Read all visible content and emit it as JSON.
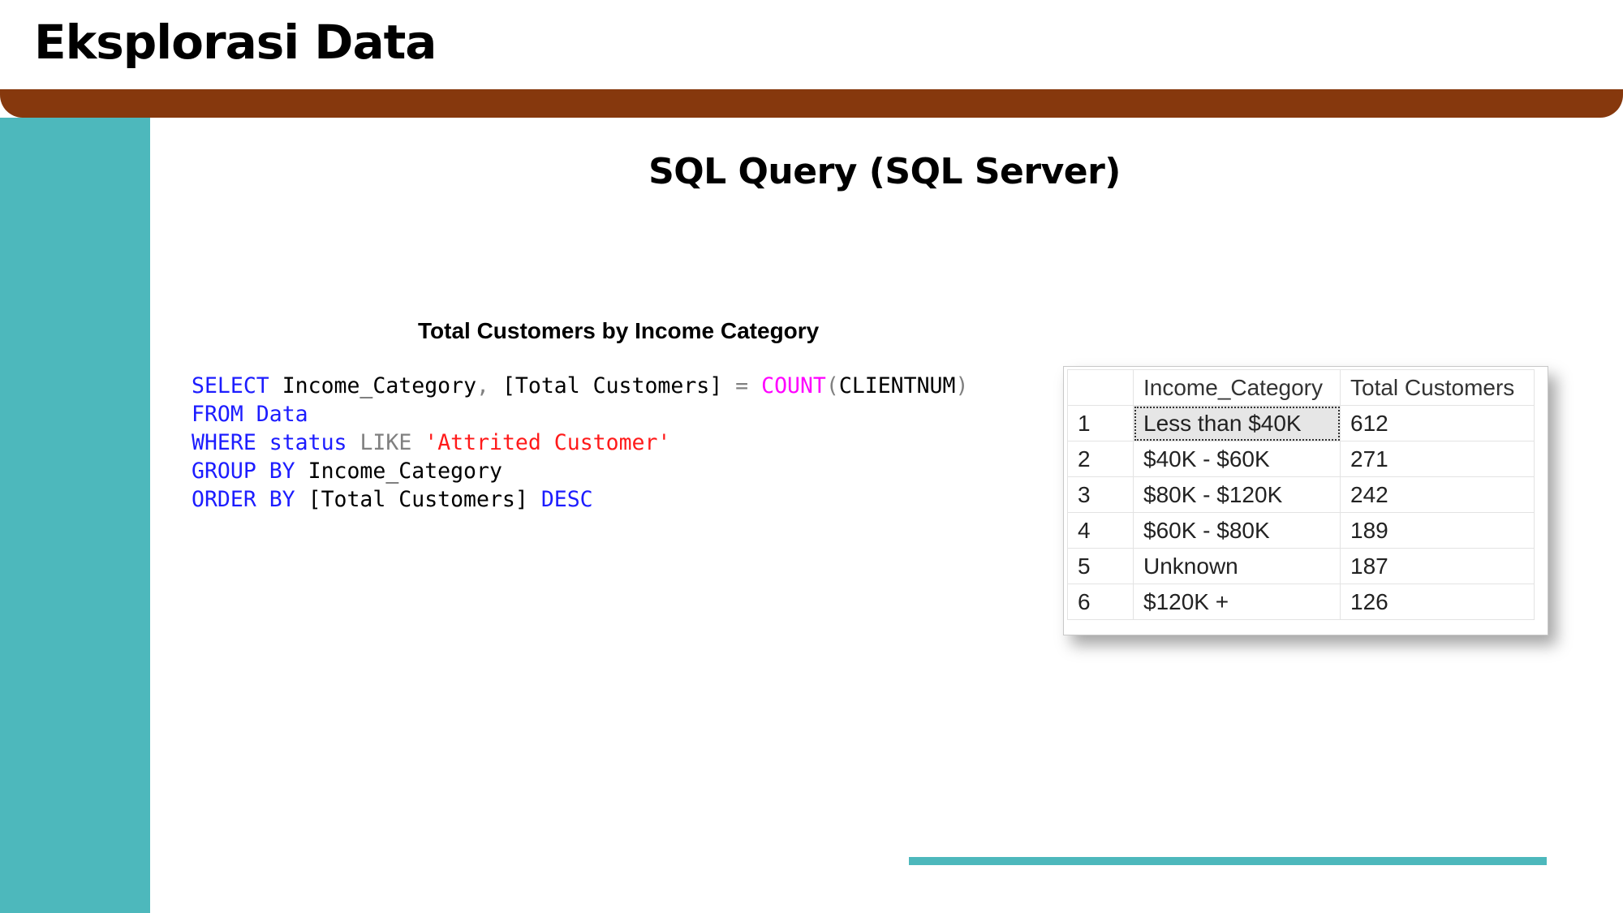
{
  "slide": {
    "title": "Eksplorasi Data",
    "subtitle": "SQL Query (SQL Server)",
    "section_title": "Total Customers by Income Category"
  },
  "sql": {
    "select": "SELECT",
    "col1": "Income_Category",
    "comma": ",",
    "alias": "[Total Customers]",
    "equals": "=",
    "count_fn": "COUNT",
    "paren_open": "(",
    "count_arg": "CLIENTNUM",
    "paren_close": ")",
    "from": "FROM",
    "table": "Data",
    "where": "WHERE",
    "where_col": "status",
    "like": "LIKE",
    "literal": "'Attrited Customer'",
    "group_by": "GROUP BY",
    "group_col": "Income_Category",
    "order_by": "ORDER BY",
    "order_col": "[Total Customers]",
    "desc": "DESC"
  },
  "results": {
    "columns": [
      "Income_Category",
      "Total Customers"
    ],
    "rows": [
      {
        "num": "1",
        "category": "Less than $40K",
        "total": "612"
      },
      {
        "num": "2",
        "category": "$40K - $60K",
        "total": "271"
      },
      {
        "num": "3",
        "category": "$80K - $120K",
        "total": "242"
      },
      {
        "num": "4",
        "category": "$60K - $80K",
        "total": "189"
      },
      {
        "num": "5",
        "category": "Unknown",
        "total": "187"
      },
      {
        "num": "6",
        "category": "$120K +",
        "total": "126"
      }
    ]
  },
  "colors": {
    "header_band": "#86380d",
    "accent_teal": "#4db8bc",
    "sql_keyword": "#1c1cff",
    "sql_function": "#ff00ff",
    "sql_string": "#ff1a1a",
    "sql_operator": "#808080"
  }
}
